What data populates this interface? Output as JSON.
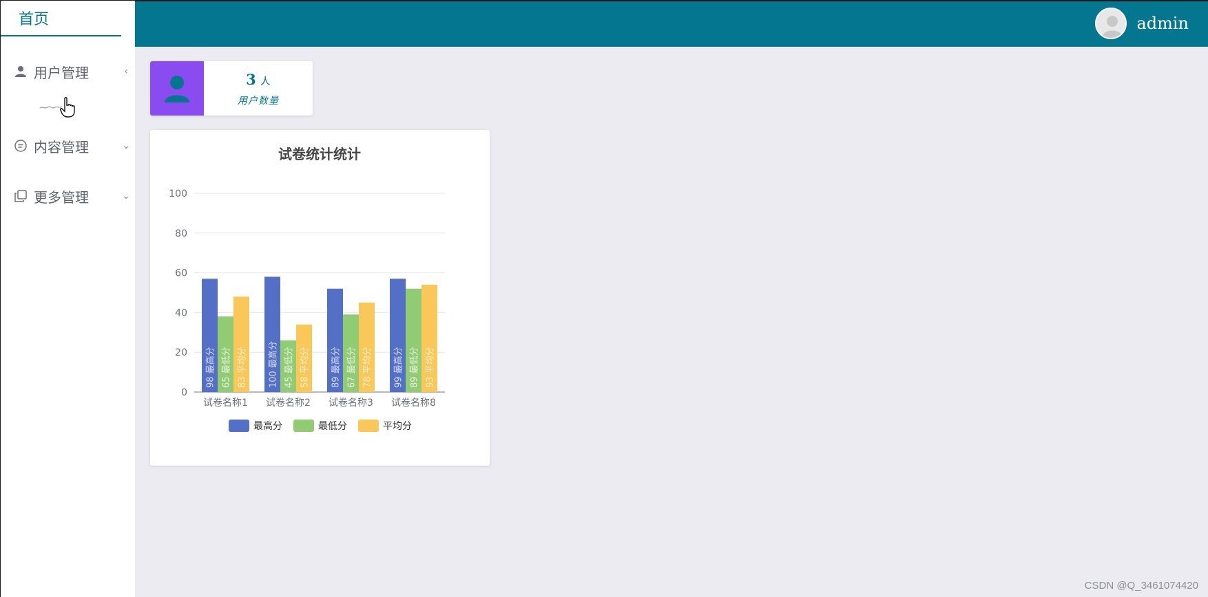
{
  "sidebar": {
    "home_label": "首页",
    "items": [
      {
        "label": "用户管理",
        "icon": "user-icon",
        "arrow": "‹"
      },
      {
        "label": "内容管理",
        "icon": "chat-icon",
        "arrow": "⌄"
      },
      {
        "label": "更多管理",
        "icon": "copy-icon",
        "arrow": "⌄"
      }
    ]
  },
  "header": {
    "username": "admin",
    "bg_color": "#047690"
  },
  "stat": {
    "value": "3",
    "unit": "人",
    "label": "用户数量",
    "accent": "#8a4bf0"
  },
  "chart_data": {
    "type": "bar",
    "title": "试卷统计统计",
    "categories": [
      "试卷名称1",
      "试卷名称2",
      "试卷名称3",
      "试卷名称8"
    ],
    "ylim": [
      0,
      100
    ],
    "yticks": [
      0,
      20,
      40,
      60,
      80,
      100
    ],
    "grid": true,
    "legend_position": "bottom",
    "series": [
      {
        "name": "最高分",
        "color": "#5470c6",
        "values": [
          57,
          58,
          52,
          57
        ],
        "labels": [
          "98",
          "100",
          "89",
          "99"
        ]
      },
      {
        "name": "最低分",
        "color": "#91cc75",
        "values": [
          38,
          26,
          39,
          52
        ],
        "labels": [
          "65",
          "45",
          "67",
          "89"
        ]
      },
      {
        "name": "平均分",
        "color": "#fac858",
        "values": [
          48,
          34,
          45,
          54
        ],
        "labels": [
          "83",
          "58",
          "78",
          "93"
        ]
      }
    ]
  },
  "watermark": "CSDN @Q_3461074420"
}
